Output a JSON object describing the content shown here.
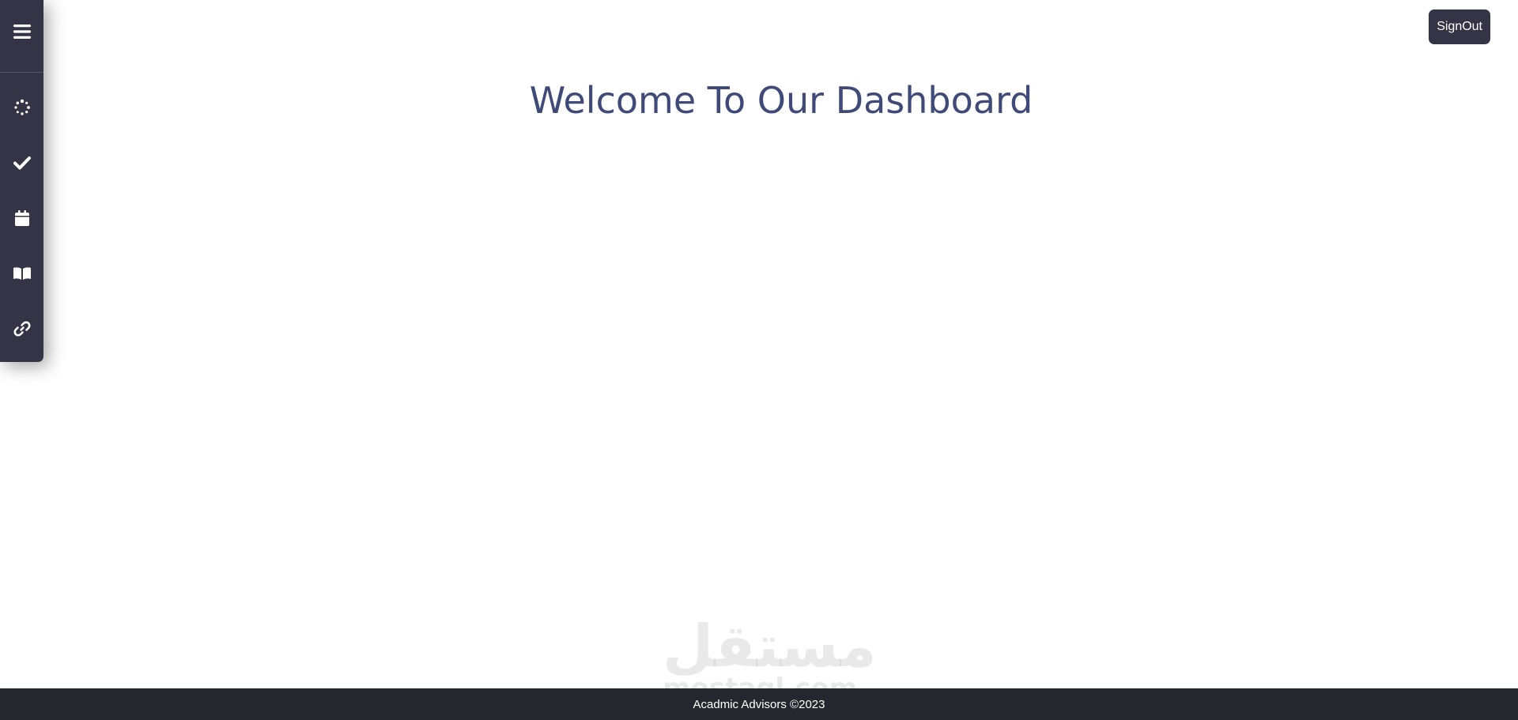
{
  "header": {
    "signout_label": "SignOut"
  },
  "main": {
    "welcome_title": "Welcome To Our Dashboard"
  },
  "sidebar": {
    "icons": [
      "menu-icon",
      "spinner-icon",
      "check-icon",
      "calendar-icon",
      "book-icon",
      "link-icon"
    ]
  },
  "watermark": {
    "arabic": "مستقل",
    "latin": "mostaql.com"
  },
  "footer": {
    "copyright": "Acadmic Advisors ©2023"
  },
  "colors": {
    "sidebar_bg": "#343446",
    "title": "#3f4a78",
    "footer_bg": "#24272e",
    "button_bg": "#343446"
  }
}
